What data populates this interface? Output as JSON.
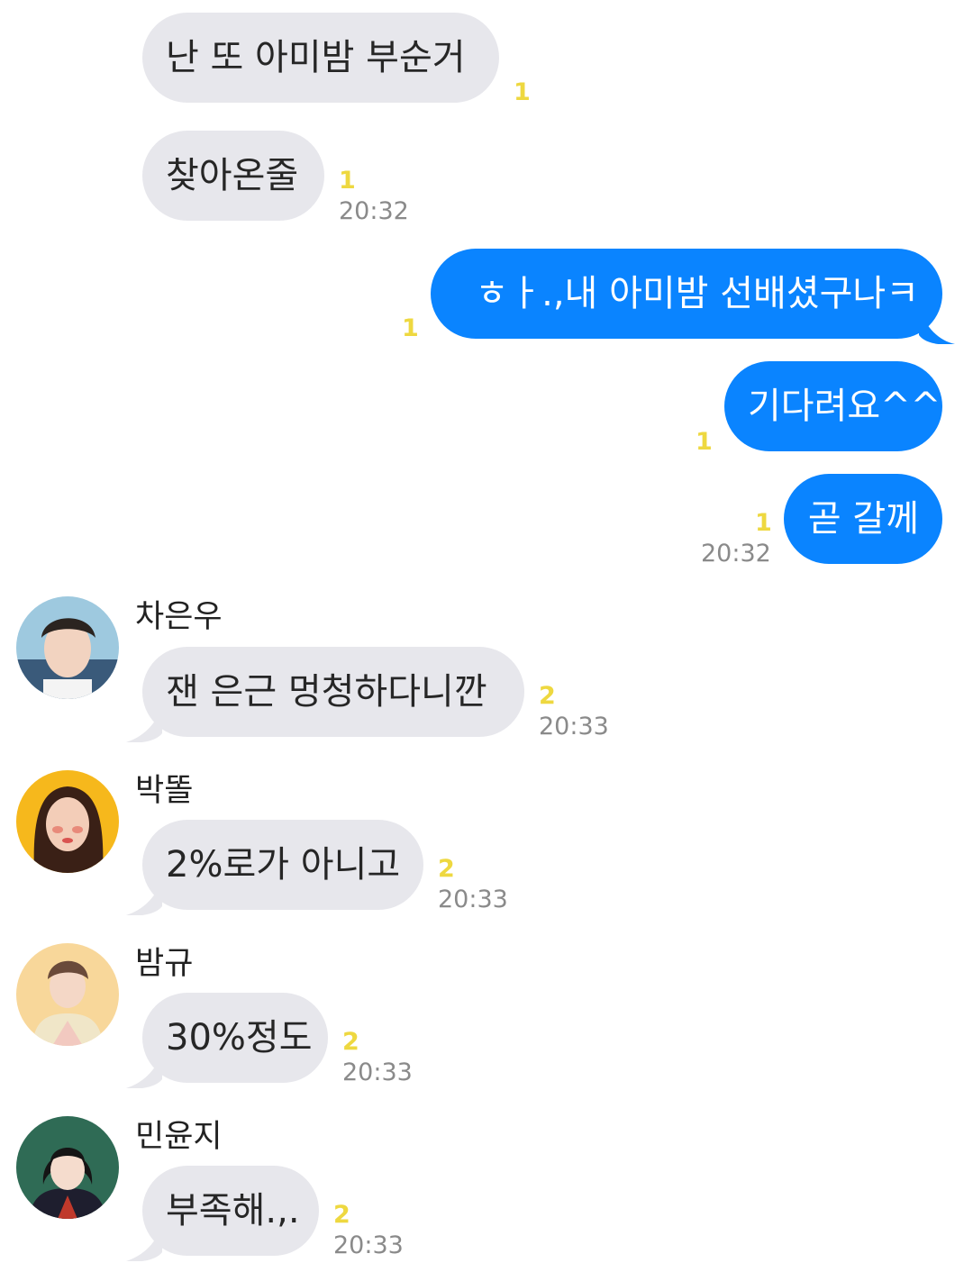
{
  "colors": {
    "incoming_bubble": "#e7e7ec",
    "outgoing_bubble": "#0a84ff",
    "unread_count": "#eed840",
    "timestamp": "#8a8a8a"
  },
  "messages": [
    {
      "sender": "",
      "direction": "incoming",
      "text": "난 또 아미밤 부순거",
      "unread": "1",
      "time": ""
    },
    {
      "sender": "",
      "direction": "incoming",
      "text": "찾아온줄",
      "unread": "1",
      "time": "20:32"
    },
    {
      "sender": "",
      "direction": "outgoing",
      "text": "ㅎㅏ.,내 아미밤 선배셨구나ㅋ",
      "unread": "1",
      "time": ""
    },
    {
      "sender": "",
      "direction": "outgoing",
      "text": "기다려요^^",
      "unread": "1",
      "time": ""
    },
    {
      "sender": "",
      "direction": "outgoing",
      "text": "곧 갈께",
      "unread": "1",
      "time": "20:32"
    },
    {
      "sender": "차은우",
      "avatar_icon": "avatar-photo-icon",
      "direction": "incoming",
      "text": "잰 은근 멍청하다니깐",
      "unread": "2",
      "time": "20:33"
    },
    {
      "sender": "박똘",
      "avatar_icon": "avatar-photo-icon",
      "direction": "incoming",
      "text": "2%로가 아니고",
      "unread": "2",
      "time": "20:33"
    },
    {
      "sender": "밤규",
      "avatar_icon": "avatar-photo-icon",
      "direction": "incoming",
      "text": "30%정도",
      "unread": "2",
      "time": "20:33"
    },
    {
      "sender": "민윤지",
      "avatar_icon": "avatar-photo-icon",
      "direction": "incoming",
      "text": "부족해.,.",
      "unread": "2",
      "time": "20:33"
    }
  ]
}
